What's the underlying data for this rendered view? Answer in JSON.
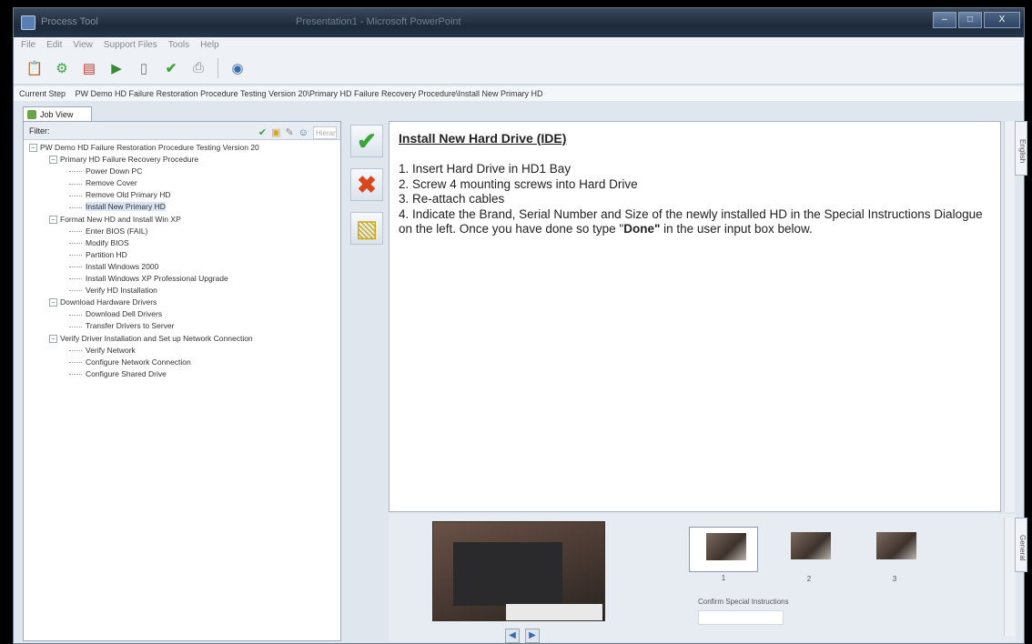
{
  "window": {
    "app_name": "Process Tool",
    "doc_title": "Presentation1 - Microsoft PowerPoint",
    "controls": [
      "–",
      "□",
      "X"
    ]
  },
  "menu": [
    "File",
    "Edit",
    "View",
    "Support Files",
    "Tools",
    "Help"
  ],
  "toolbar_icons": [
    "clipboard-icon",
    "gear-icon",
    "calendar-icon",
    "export-icon",
    "document-icon",
    "checkmark-icon",
    "printer-icon",
    "globe-icon"
  ],
  "current_step": {
    "label": "Current Step",
    "path": "PW Demo HD Failure Restoration Procedure Testing Version 20\\Primary HD Failure Recovery Procedure\\Install New Primary HD"
  },
  "left_pane": {
    "tab_label": "Job View",
    "filter_label": "Filter:",
    "filter_placeholder": "Hierar"
  },
  "tree": [
    {
      "indent": 0,
      "expander": "–",
      "label": "PW Demo HD Failure Restoration Procedure Testing Version 20"
    },
    {
      "indent": 1,
      "expander": "–",
      "label": "Primary HD Failure Recovery Procedure"
    },
    {
      "indent": 2,
      "expander": "",
      "label": "Power Down PC"
    },
    {
      "indent": 2,
      "expander": "",
      "label": "Remove Cover"
    },
    {
      "indent": 2,
      "expander": "",
      "label": "Remove Old Primary HD"
    },
    {
      "indent": 2,
      "expander": "",
      "label": "Install New Primary HD",
      "selected": true
    },
    {
      "indent": 1,
      "expander": "–",
      "label": "Format New HD and Install Win XP"
    },
    {
      "indent": 2,
      "expander": "",
      "label": "Enter BIOS (FAIL)"
    },
    {
      "indent": 2,
      "expander": "",
      "label": "Modify BIOS"
    },
    {
      "indent": 2,
      "expander": "",
      "label": "Partition HD"
    },
    {
      "indent": 2,
      "expander": "",
      "label": "Install Windows 2000"
    },
    {
      "indent": 2,
      "expander": "",
      "label": "Install Windows XP Professional Upgrade"
    },
    {
      "indent": 2,
      "expander": "",
      "label": "Verify HD Installation"
    },
    {
      "indent": 1,
      "expander": "–",
      "label": "Download Hardware Drivers"
    },
    {
      "indent": 2,
      "expander": "",
      "label": "Download Dell Drivers"
    },
    {
      "indent": 2,
      "expander": "",
      "label": "Transfer Drivers to Server"
    },
    {
      "indent": 1,
      "expander": "–",
      "label": "Verify Driver Installation and Set up Network Connection"
    },
    {
      "indent": 2,
      "expander": "",
      "label": "Verify Network"
    },
    {
      "indent": 2,
      "expander": "",
      "label": "Configure Network Connection"
    },
    {
      "indent": 2,
      "expander": "",
      "label": "Configure Shared Drive"
    }
  ],
  "instructions": {
    "title": "Install New Hard Drive (IDE)",
    "steps": [
      "1. Insert Hard Drive in HD1 Bay",
      "2. Screw 4 mounting screws into Hard Drive",
      "3. Re-attach cables"
    ],
    "step4_prefix": "4. Indicate the Brand, Serial Number and Size of the newly installed HD in the Special Instructions Dialogue on the left. Once you have done so type \"",
    "step4_bold": "Done\"",
    "step4_suffix": " in the user input box below."
  },
  "side_tabs": {
    "top": "English",
    "bottom": "General"
  },
  "thumbnails": [
    "1",
    "2",
    "3"
  ],
  "confirm": {
    "label": "Confirm Special Instructions"
  }
}
